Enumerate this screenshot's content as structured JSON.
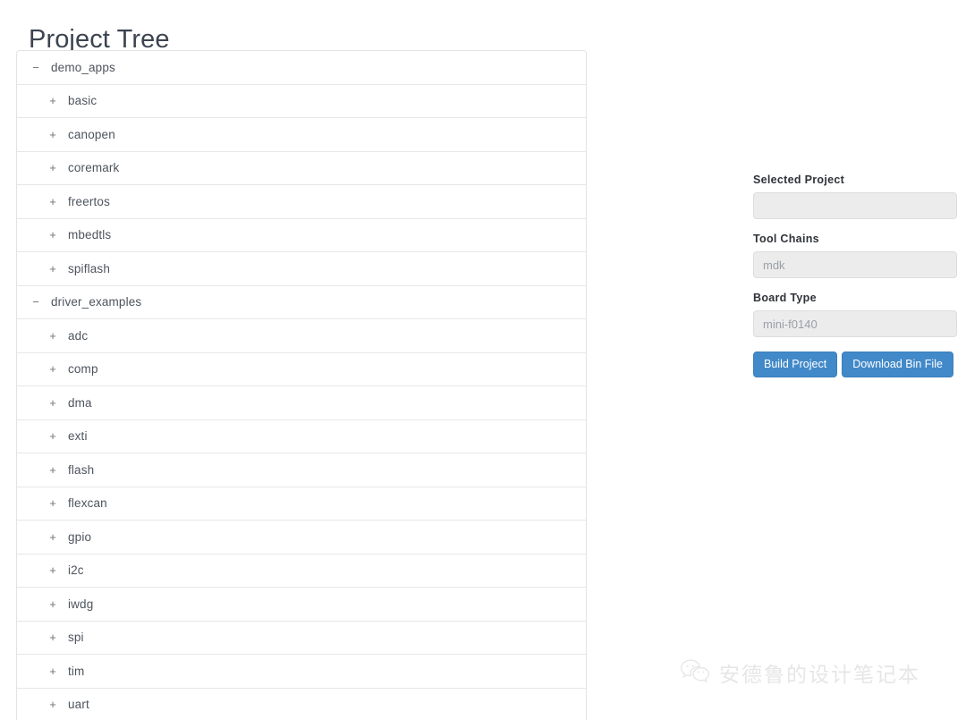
{
  "page": {
    "title": "Project Tree"
  },
  "tree": {
    "expand_icon": "+",
    "collapse_icon": "−",
    "nodes": [
      {
        "label": "demo_apps",
        "level": 0,
        "state": "expanded"
      },
      {
        "label": "basic",
        "level": 1,
        "state": "collapsed"
      },
      {
        "label": "canopen",
        "level": 1,
        "state": "collapsed"
      },
      {
        "label": "coremark",
        "level": 1,
        "state": "collapsed"
      },
      {
        "label": "freertos",
        "level": 1,
        "state": "collapsed"
      },
      {
        "label": "mbedtls",
        "level": 1,
        "state": "collapsed"
      },
      {
        "label": "spiflash",
        "level": 1,
        "state": "collapsed"
      },
      {
        "label": "driver_examples",
        "level": 0,
        "state": "expanded"
      },
      {
        "label": "adc",
        "level": 1,
        "state": "collapsed"
      },
      {
        "label": "comp",
        "level": 1,
        "state": "collapsed"
      },
      {
        "label": "dma",
        "level": 1,
        "state": "collapsed"
      },
      {
        "label": "exti",
        "level": 1,
        "state": "collapsed"
      },
      {
        "label": "flash",
        "level": 1,
        "state": "collapsed"
      },
      {
        "label": "flexcan",
        "level": 1,
        "state": "collapsed"
      },
      {
        "label": "gpio",
        "level": 1,
        "state": "collapsed"
      },
      {
        "label": "i2c",
        "level": 1,
        "state": "collapsed"
      },
      {
        "label": "iwdg",
        "level": 1,
        "state": "collapsed"
      },
      {
        "label": "spi",
        "level": 1,
        "state": "collapsed"
      },
      {
        "label": "tim",
        "level": 1,
        "state": "collapsed"
      },
      {
        "label": "uart",
        "level": 1,
        "state": "collapsed"
      }
    ]
  },
  "form": {
    "fields": [
      {
        "label": "Selected Project",
        "value": "",
        "placeholder": ""
      },
      {
        "label": "Tool Chains",
        "value": "",
        "placeholder": "mdk"
      },
      {
        "label": "Board Type",
        "value": "",
        "placeholder": "mini-f0140"
      }
    ],
    "buttons": [
      {
        "label": "Build Project"
      },
      {
        "label": "Download Bin File"
      }
    ]
  },
  "watermark": {
    "icon": "wechat-icon",
    "text": "安德鲁的设计笔记本"
  },
  "colors": {
    "accent": "#4189c8",
    "panel_border": "#e3e3e3",
    "row_divider": "#e7e7e7",
    "input_bg": "#ececec",
    "title_text": "#3c4450"
  }
}
